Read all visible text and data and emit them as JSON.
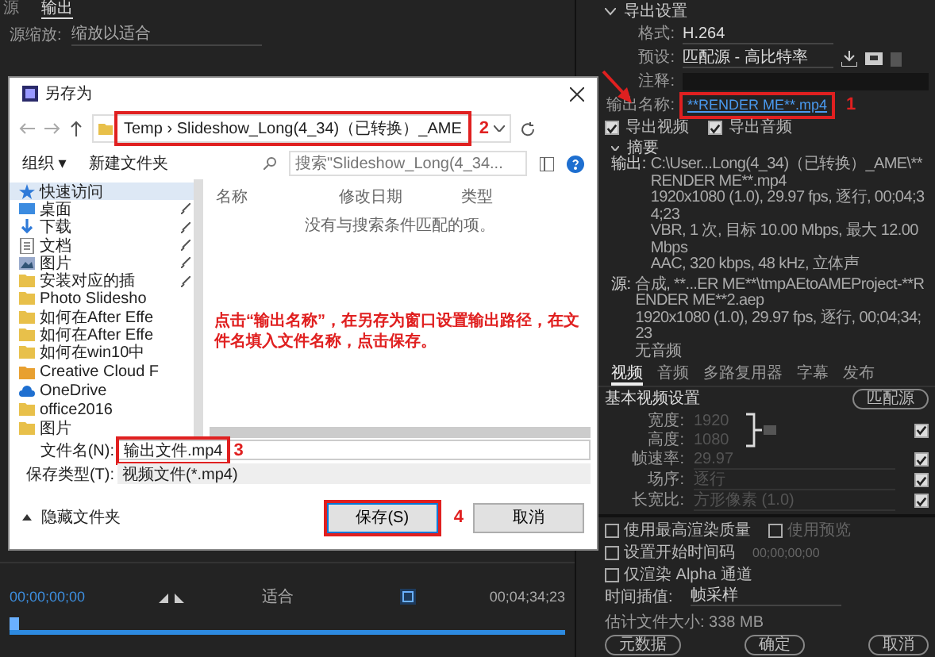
{
  "source_panel": {
    "tabs": [
      {
        "label": "源",
        "selected": false
      },
      {
        "label": "输出",
        "selected": true
      }
    ],
    "scale_label": "源缩放:",
    "scale_value": "缩放以适合"
  },
  "timeline": {
    "start_time": "00;00;00;00",
    "fit": "适合",
    "end_time": "00;04;34;23",
    "level": 0
  },
  "save_dialog": {
    "title": "另存为",
    "path": {
      "text": "Temp › Slideshow_Long(4_34)（已转换）_AME",
      "highlight": "2"
    },
    "search_placeholder": "搜索\"Slideshow_Long(4_34...",
    "organize": "组织 ▾",
    "new_folder": "新建文件夹",
    "sidebar": [
      {
        "label": "快速访问",
        "kind": "star",
        "pinned": false,
        "selected": true
      },
      {
        "label": "桌面",
        "kind": "desktop",
        "pinned": true,
        "selected": false
      },
      {
        "label": "下载",
        "kind": "download",
        "pinned": true,
        "selected": false
      },
      {
        "label": "文档",
        "kind": "document",
        "pinned": true,
        "selected": false
      },
      {
        "label": "图片",
        "kind": "picture",
        "pinned": true,
        "selected": false
      },
      {
        "label": "安装对应的插",
        "kind": "folder",
        "pinned": true,
        "selected": false
      },
      {
        "label": "Photo Slidesho",
        "kind": "folder",
        "pinned": false,
        "selected": false
      },
      {
        "label": "如何在After Effe",
        "kind": "folder",
        "pinned": false,
        "selected": false
      },
      {
        "label": "如何在After Effe",
        "kind": "folder",
        "pinned": false,
        "selected": false
      },
      {
        "label": "如何在win10中",
        "kind": "folder",
        "pinned": false,
        "selected": false
      },
      {
        "label": "Creative Cloud F",
        "kind": "cloud-folder",
        "pinned": false,
        "selected": false
      },
      {
        "label": "OneDrive",
        "kind": "cloud",
        "pinned": false,
        "selected": false
      },
      {
        "label": "office2016",
        "kind": "folder",
        "pinned": false,
        "selected": false
      },
      {
        "label": "图片",
        "kind": "folder",
        "pinned": false,
        "selected": false
      }
    ],
    "columns": [
      "名称",
      "修改日期",
      "类型"
    ],
    "empty_message": "没有与搜索条件匹配的项。",
    "file_name_label": "文件名(N):",
    "file_name": {
      "text": "输出文件.mp4",
      "highlight": "3"
    },
    "file_type_label": "保存类型(T):",
    "file_type": "视频文件(*.mp4)",
    "hide_folders": "隐藏文件夹",
    "save_button": {
      "text": "保存(S)",
      "highlight": "4"
    },
    "cancel_button": "取消"
  },
  "export_settings": {
    "heading": "导出设置",
    "format_label": "格式:",
    "format": "H.264",
    "preset_label": "预设:",
    "preset": "匹配源 - 高比特率",
    "comment_label": "注释:",
    "output_name_label": "输出名称:",
    "output_name": {
      "text": "**RENDER ME**.mp4",
      "highlight": "1"
    },
    "export_video": {
      "label": "导出视频",
      "checked": true
    },
    "export_audio": {
      "label": "导出音频",
      "checked": true
    },
    "summary_heading": "摘要",
    "output_label": "输出:",
    "output_lines": [
      "C:\\User...Long(4_34)（已转换）_AME\\**RENDER ME**.mp4",
      "1920x1080 (1.0), 29.97 fps, 逐行, 00;04;34;23",
      "VBR, 1 次, 目标 10.00 Mbps, 最大 12.00 Mbps",
      "AAC, 320 kbps, 48 kHz, 立体声"
    ],
    "source_label": "源:",
    "source_lines": [
      "合成, **...ER ME**\\tmpAEtoAMEProject-**RENDER ME**2.aep",
      "1920x1080 (1.0), 29.97 fps, 逐行, 00;04;34;23",
      "无音频"
    ],
    "tabs": [
      {
        "label": "视频",
        "selected": true
      },
      {
        "label": "音频",
        "selected": false
      },
      {
        "label": "多路复用器",
        "selected": false
      },
      {
        "label": "字幕",
        "selected": false
      },
      {
        "label": "发布",
        "selected": false
      }
    ],
    "video_heading": "基本视频设置",
    "match_source": "匹配源",
    "size": [
      {
        "label": "宽度:",
        "value": "1920"
      },
      {
        "label": "高度:",
        "value": "1080"
      }
    ],
    "size_checked": true,
    "settings": [
      {
        "label": "帧速率:",
        "value": "29.97",
        "checked": true
      },
      {
        "label": "场序:",
        "value": "逐行",
        "checked": true
      },
      {
        "label": "长宽比:",
        "value": "方形像素 (1.0)",
        "checked": true
      }
    ],
    "options": [
      {
        "label": "使用最高渲染质量",
        "checked": false
      },
      {
        "label": "使用预览",
        "checked": false
      },
      {
        "label": "设置开始时间码",
        "checked": false,
        "value": "00;00;00;00"
      },
      {
        "label": "仅渲染 Alpha 通道",
        "checked": false
      }
    ],
    "interp_label": "时间插值:",
    "interp": "帧采样",
    "size_estimate": "估计文件大小: 338 MB",
    "buttons": [
      "元数据",
      "确定",
      "取消"
    ]
  },
  "annotations": {
    "instruction": "点击“输出名称”，在另存为窗口设置输出路径，在文件名填入文件名称，点击保存。"
  }
}
